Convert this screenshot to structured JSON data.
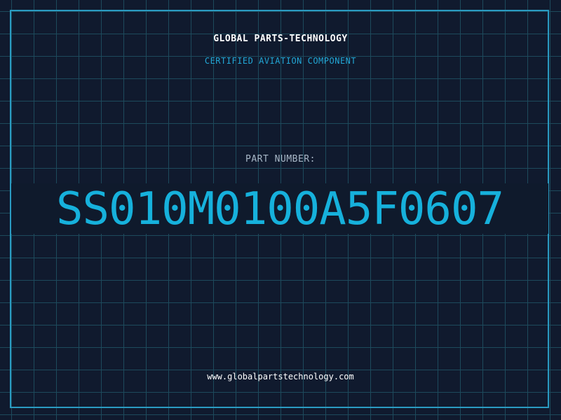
{
  "header": {
    "company": "GLOBAL PARTS-TECHNOLOGY",
    "subtitle": "CERTIFIED AVIATION COMPONENT"
  },
  "part": {
    "label": "PART NUMBER:",
    "number": "SS010M0100A5F0607"
  },
  "footer": {
    "website": "www.globalpartstechnology.com"
  },
  "colors": {
    "background": "#101a2e",
    "grid": "#1d4a5c",
    "accent": "#16b1dc",
    "frame": "#2a9bc2"
  }
}
